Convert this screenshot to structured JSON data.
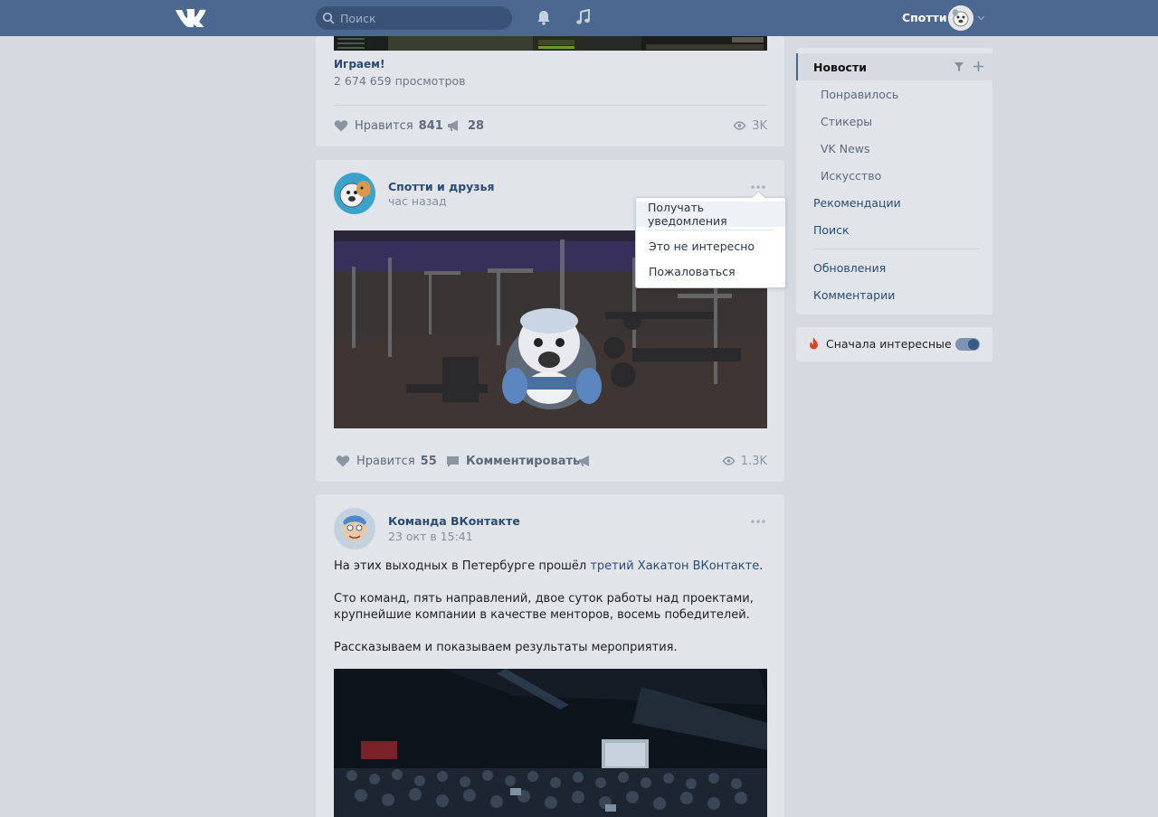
{
  "header": {
    "search_placeholder": "Поиск",
    "user_name": "Спотти"
  },
  "feed": {
    "post1": {
      "title": "Играем!",
      "views_text": "2 674 659 просмотров",
      "like_label": "Нравится",
      "like_count": "841",
      "share_count": "28",
      "views_count": "3K"
    },
    "post2": {
      "author": "Спотти и друзья",
      "time": "час назад",
      "like_label": "Нравится",
      "like_count": "55",
      "comment_label": "Комментировать",
      "views_count": "1.3K"
    },
    "post3": {
      "author": "Команда ВКонтакте",
      "time": "23 окт в 15:41",
      "text_before_link": "На этих выходных в Петербурге прошёл ",
      "link": "третий Хакатон ВКонтакте",
      "text_after_link": ".",
      "paragraph2": "Сто команд, пять направлений, двое суток работы над проектами, крупнейшие компании в качестве менторов, восемь победителей.",
      "paragraph3": "Рассказываем и показываем результаты мероприятия."
    }
  },
  "post_menu": {
    "items": [
      "Получать уведомления",
      "Это не интересно",
      "Пожаловаться"
    ]
  },
  "sidebar": {
    "items": [
      {
        "label": "Новости"
      },
      {
        "label": "Понравилось"
      },
      {
        "label": "Стикеры"
      },
      {
        "label": "VK News"
      },
      {
        "label": "Искусство"
      },
      {
        "label": "Рекомендации"
      },
      {
        "label": "Поиск"
      },
      {
        "label": "Обновления"
      },
      {
        "label": "Комментарии"
      }
    ],
    "toggle_label": "Сначала интересные",
    "toggle_on": true
  },
  "colors": {
    "header": "#4a6890",
    "link": "#2a4a72",
    "page_bg": "#d5dae0"
  }
}
